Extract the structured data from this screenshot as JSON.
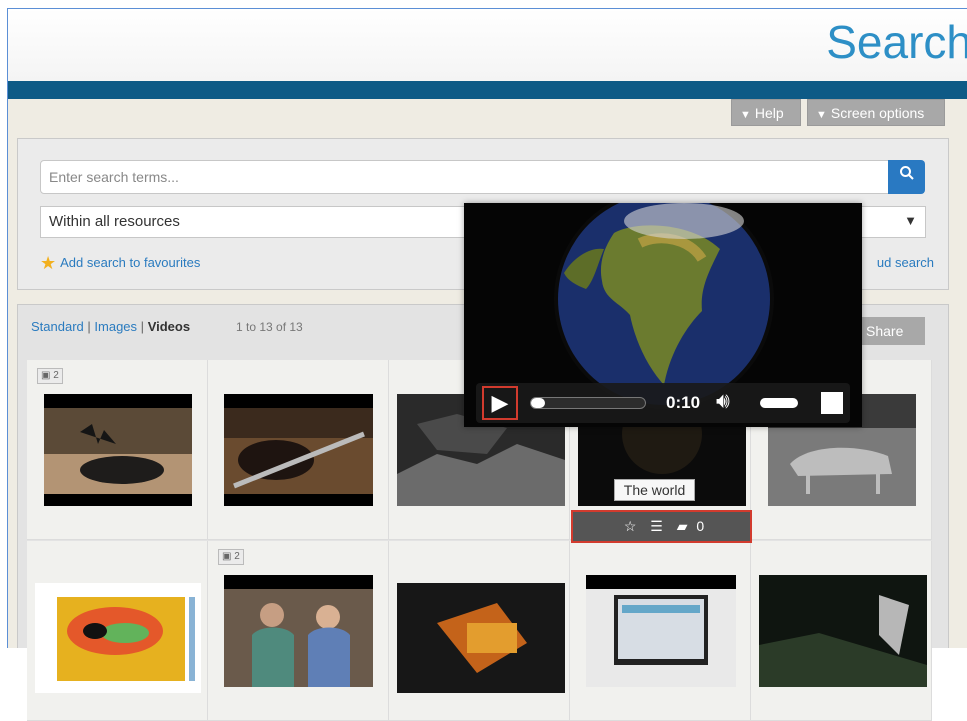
{
  "header": {
    "title": "Search"
  },
  "toolbar": {
    "help_label": "Help",
    "screen_options_label": "Screen options"
  },
  "search": {
    "placeholder": "Enter search terms...",
    "scope_value": "Within all resources",
    "add_favourite_label": "Add search to favourites",
    "cloud_search_label": "ud search"
  },
  "results": {
    "view_standard": "Standard",
    "view_images": "Images",
    "view_videos": "Videos",
    "separator": "|",
    "count_text": "1 to 13 of 13",
    "share_label": "Share"
  },
  "grid": {
    "badges": [
      "2",
      "2"
    ]
  },
  "player": {
    "time": "0:10",
    "progress_fraction": 0.1
  },
  "tooltip": {
    "text": "The world"
  },
  "actions": {
    "comment_count": "0"
  },
  "icons": {
    "play": "play-icon",
    "volume": "volume-icon",
    "fullscreen": "fullscreen-icon",
    "star": "star-icon",
    "list": "list-icon",
    "comment": "comment-icon",
    "search": "search-icon",
    "film": "film-icon"
  },
  "colors": {
    "brand": "#2d8fc6",
    "header_bar": "#0e5a86",
    "accent_red": "#d23b2e",
    "link": "#2a7bbf"
  }
}
